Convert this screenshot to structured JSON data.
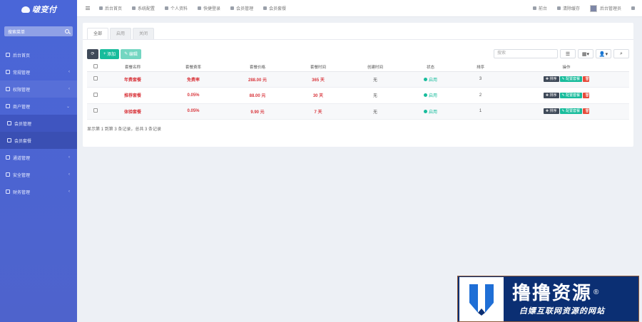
{
  "sidebar": {
    "logo": "啵变付",
    "search_placeholder": "搜索菜单",
    "items": [
      {
        "label": "后台首页"
      },
      {
        "label": "常规管理",
        "chev": "‹"
      },
      {
        "label": "权限管理",
        "chev": "‹"
      },
      {
        "label": "商户管理",
        "chev": "⌄"
      }
    ],
    "sub_items": [
      {
        "label": "会员管理"
      },
      {
        "label": "会员套餐"
      }
    ],
    "items2": [
      {
        "label": "通道管理",
        "chev": "‹"
      },
      {
        "label": "安全管理",
        "chev": "‹"
      },
      {
        "label": "财务管理",
        "chev": "‹"
      }
    ]
  },
  "topbar": {
    "items": [
      "后台首页",
      "系统配置",
      "个人资料",
      "快捷登录",
      "会员管理",
      "会员套餐"
    ],
    "right": {
      "home": "前台",
      "clear": "清除缓存",
      "user": "后台管理员"
    }
  },
  "tabs": [
    "全部",
    "启用",
    "关闭"
  ],
  "toolbar": {
    "add": "添加",
    "edit": "编辑",
    "search_placeholder": "搜索"
  },
  "table": {
    "headers": [
      "套餐名称",
      "套餐费率",
      "套餐价格",
      "套餐时间",
      "创建时间",
      "状态",
      "排序",
      "操作"
    ],
    "rows": [
      {
        "name": "年费套餐",
        "rate": "免费率",
        "price": "288.00 元",
        "duration": "365 天",
        "created": "无",
        "status": "启用",
        "sort": "3"
      },
      {
        "name": "推荐套餐",
        "rate": "0.05%",
        "price": "88.00 元",
        "duration": "30 天",
        "created": "无",
        "status": "启用",
        "sort": "2"
      },
      {
        "name": "体验套餐",
        "rate": "0.05%",
        "price": "9.90 元",
        "duration": "7 天",
        "created": "无",
        "status": "启用",
        "sort": "1"
      }
    ],
    "ops": {
      "sort": "排序",
      "config": "配置套餐"
    }
  },
  "pagination_text": "显示第 1 到第 3 条记录，总共 3 条记录",
  "watermark": {
    "title": "撸撸资源",
    "mark": "®",
    "subtitle": "白嫖互联网资源的网站"
  },
  "colors": {
    "sidebar": "#4a66d8",
    "accent": "#18bc9c",
    "danger": "#e74c3c",
    "price_red": "#d9383e"
  }
}
